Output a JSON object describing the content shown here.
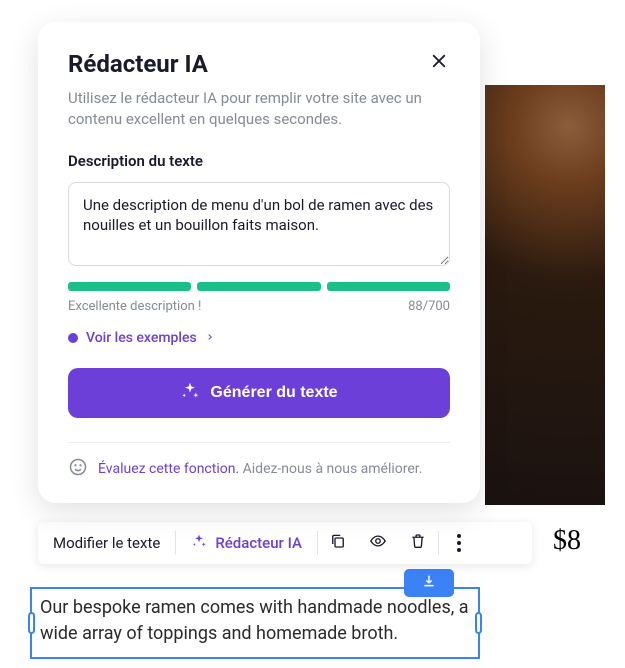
{
  "modal": {
    "title": "Rédacteur IA",
    "subtitle": "Utilisez le rédacteur IA pour remplir votre site avec un contenu excellent en quelques secondes.",
    "section_label": "Description du texte",
    "textarea_value": "Une description de menu d'un bol de ramen avec des nouilles et un bouillon faits maison.",
    "quality_label": "Excellente description !",
    "char_count": "88/700",
    "examples_label": "Voir les exemples",
    "generate_label": "Générer du texte",
    "rating_link": "Évaluez cette fonction.",
    "rating_help": "Aidez-nous à nous améliorer."
  },
  "toolbar": {
    "edit_text": "Modifier le texte",
    "ai_writer": "Rédacteur IA"
  },
  "content": {
    "selected_text": "Our bespoke ramen comes with handmade noodles, a wide array of toppings and homemade broth.",
    "price": "$8"
  },
  "colors": {
    "primary": "#6c3fd9",
    "success": "#1bbf89",
    "selection": "#3b82f6"
  }
}
